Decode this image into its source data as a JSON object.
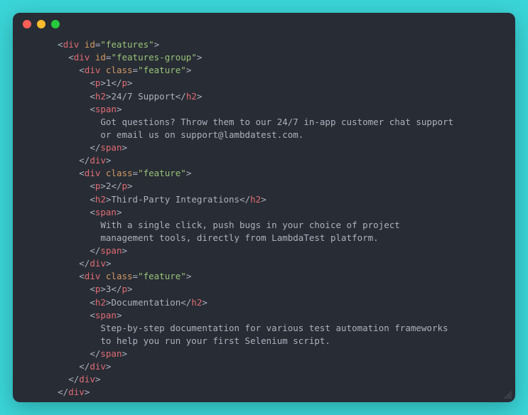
{
  "code": {
    "lines": [
      {
        "indent": 3,
        "tokens": [
          {
            "c": "p",
            "t": "<"
          },
          {
            "c": "tg",
            "t": "div"
          },
          {
            "c": "p",
            "t": " "
          },
          {
            "c": "an",
            "t": "id"
          },
          {
            "c": "p",
            "t": "="
          },
          {
            "c": "av",
            "t": "\"features\""
          },
          {
            "c": "p",
            "t": ">"
          }
        ]
      },
      {
        "indent": 4,
        "tokens": [
          {
            "c": "p",
            "t": "<"
          },
          {
            "c": "tg",
            "t": "div"
          },
          {
            "c": "p",
            "t": " "
          },
          {
            "c": "an",
            "t": "id"
          },
          {
            "c": "p",
            "t": "="
          },
          {
            "c": "av",
            "t": "\"features-group\""
          },
          {
            "c": "p",
            "t": ">"
          }
        ]
      },
      {
        "indent": 5,
        "tokens": [
          {
            "c": "p",
            "t": "<"
          },
          {
            "c": "tg",
            "t": "div"
          },
          {
            "c": "p",
            "t": " "
          },
          {
            "c": "an",
            "t": "class"
          },
          {
            "c": "p",
            "t": "="
          },
          {
            "c": "av",
            "t": "\"feature\""
          },
          {
            "c": "p",
            "t": ">"
          }
        ]
      },
      {
        "indent": 6,
        "tokens": [
          {
            "c": "p",
            "t": "<"
          },
          {
            "c": "tg",
            "t": "p"
          },
          {
            "c": "p",
            "t": ">"
          },
          {
            "c": "tx",
            "t": "1"
          },
          {
            "c": "p",
            "t": "</"
          },
          {
            "c": "tg",
            "t": "p"
          },
          {
            "c": "p",
            "t": ">"
          }
        ]
      },
      {
        "indent": 6,
        "tokens": [
          {
            "c": "p",
            "t": "<"
          },
          {
            "c": "tg",
            "t": "h2"
          },
          {
            "c": "p",
            "t": ">"
          },
          {
            "c": "tx",
            "t": "24/7 Support"
          },
          {
            "c": "p",
            "t": "</"
          },
          {
            "c": "tg",
            "t": "h2"
          },
          {
            "c": "p",
            "t": ">"
          }
        ]
      },
      {
        "indent": 6,
        "tokens": [
          {
            "c": "p",
            "t": "<"
          },
          {
            "c": "tg",
            "t": "span"
          },
          {
            "c": "p",
            "t": ">"
          }
        ]
      },
      {
        "indent": 7,
        "tokens": [
          {
            "c": "tx",
            "t": "Got questions? Throw them to our 24/7 in-app customer chat support"
          }
        ]
      },
      {
        "indent": 7,
        "tokens": [
          {
            "c": "tx",
            "t": "or email us on support@lambdatest.com."
          }
        ]
      },
      {
        "indent": 6,
        "tokens": [
          {
            "c": "p",
            "t": "</"
          },
          {
            "c": "tg",
            "t": "span"
          },
          {
            "c": "p",
            "t": ">"
          }
        ]
      },
      {
        "indent": 5,
        "tokens": [
          {
            "c": "p",
            "t": "</"
          },
          {
            "c": "tg",
            "t": "div"
          },
          {
            "c": "p",
            "t": ">"
          }
        ]
      },
      {
        "indent": 5,
        "tokens": [
          {
            "c": "p",
            "t": "<"
          },
          {
            "c": "tg",
            "t": "div"
          },
          {
            "c": "p",
            "t": " "
          },
          {
            "c": "an",
            "t": "class"
          },
          {
            "c": "p",
            "t": "="
          },
          {
            "c": "av",
            "t": "\"feature\""
          },
          {
            "c": "p",
            "t": ">"
          }
        ]
      },
      {
        "indent": 6,
        "tokens": [
          {
            "c": "p",
            "t": "<"
          },
          {
            "c": "tg",
            "t": "p"
          },
          {
            "c": "p",
            "t": ">"
          },
          {
            "c": "tx",
            "t": "2"
          },
          {
            "c": "p",
            "t": "</"
          },
          {
            "c": "tg",
            "t": "p"
          },
          {
            "c": "p",
            "t": ">"
          }
        ]
      },
      {
        "indent": 6,
        "tokens": [
          {
            "c": "p",
            "t": "<"
          },
          {
            "c": "tg",
            "t": "h2"
          },
          {
            "c": "p",
            "t": ">"
          },
          {
            "c": "tx",
            "t": "Third-Party Integrations"
          },
          {
            "c": "p",
            "t": "</"
          },
          {
            "c": "tg",
            "t": "h2"
          },
          {
            "c": "p",
            "t": ">"
          }
        ]
      },
      {
        "indent": 6,
        "tokens": [
          {
            "c": "p",
            "t": "<"
          },
          {
            "c": "tg",
            "t": "span"
          },
          {
            "c": "p",
            "t": ">"
          }
        ]
      },
      {
        "indent": 7,
        "tokens": [
          {
            "c": "tx",
            "t": "With a single click, push bugs in your choice of project"
          }
        ]
      },
      {
        "indent": 7,
        "tokens": [
          {
            "c": "tx",
            "t": "management tools, directly from LambdaTest platform."
          }
        ]
      },
      {
        "indent": 6,
        "tokens": [
          {
            "c": "p",
            "t": "</"
          },
          {
            "c": "tg",
            "t": "span"
          },
          {
            "c": "p",
            "t": ">"
          }
        ]
      },
      {
        "indent": 5,
        "tokens": [
          {
            "c": "p",
            "t": "</"
          },
          {
            "c": "tg",
            "t": "div"
          },
          {
            "c": "p",
            "t": ">"
          }
        ]
      },
      {
        "indent": 5,
        "tokens": [
          {
            "c": "p",
            "t": "<"
          },
          {
            "c": "tg",
            "t": "div"
          },
          {
            "c": "p",
            "t": " "
          },
          {
            "c": "an",
            "t": "class"
          },
          {
            "c": "p",
            "t": "="
          },
          {
            "c": "av",
            "t": "\"feature\""
          },
          {
            "c": "p",
            "t": ">"
          }
        ]
      },
      {
        "indent": 6,
        "tokens": [
          {
            "c": "p",
            "t": "<"
          },
          {
            "c": "tg",
            "t": "p"
          },
          {
            "c": "p",
            "t": ">"
          },
          {
            "c": "tx",
            "t": "3"
          },
          {
            "c": "p",
            "t": "</"
          },
          {
            "c": "tg",
            "t": "p"
          },
          {
            "c": "p",
            "t": ">"
          }
        ]
      },
      {
        "indent": 6,
        "tokens": [
          {
            "c": "p",
            "t": "<"
          },
          {
            "c": "tg",
            "t": "h2"
          },
          {
            "c": "p",
            "t": ">"
          },
          {
            "c": "tx",
            "t": "Documentation"
          },
          {
            "c": "p",
            "t": "</"
          },
          {
            "c": "tg",
            "t": "h2"
          },
          {
            "c": "p",
            "t": ">"
          }
        ]
      },
      {
        "indent": 6,
        "tokens": [
          {
            "c": "p",
            "t": "<"
          },
          {
            "c": "tg",
            "t": "span"
          },
          {
            "c": "p",
            "t": ">"
          }
        ]
      },
      {
        "indent": 7,
        "tokens": [
          {
            "c": "tx",
            "t": "Step-by-step documentation for various test automation frameworks"
          }
        ]
      },
      {
        "indent": 7,
        "tokens": [
          {
            "c": "tx",
            "t": "to help you run your first Selenium script."
          }
        ]
      },
      {
        "indent": 6,
        "tokens": [
          {
            "c": "p",
            "t": "</"
          },
          {
            "c": "tg",
            "t": "span"
          },
          {
            "c": "p",
            "t": ">"
          }
        ]
      },
      {
        "indent": 5,
        "tokens": [
          {
            "c": "p",
            "t": "</"
          },
          {
            "c": "tg",
            "t": "div"
          },
          {
            "c": "p",
            "t": ">"
          }
        ]
      },
      {
        "indent": 4,
        "tokens": [
          {
            "c": "p",
            "t": "</"
          },
          {
            "c": "tg",
            "t": "div"
          },
          {
            "c": "p",
            "t": ">"
          }
        ]
      },
      {
        "indent": 3,
        "tokens": [
          {
            "c": "p",
            "t": "</"
          },
          {
            "c": "tg",
            "t": "div"
          },
          {
            "c": "p",
            "t": ">"
          }
        ]
      }
    ]
  }
}
